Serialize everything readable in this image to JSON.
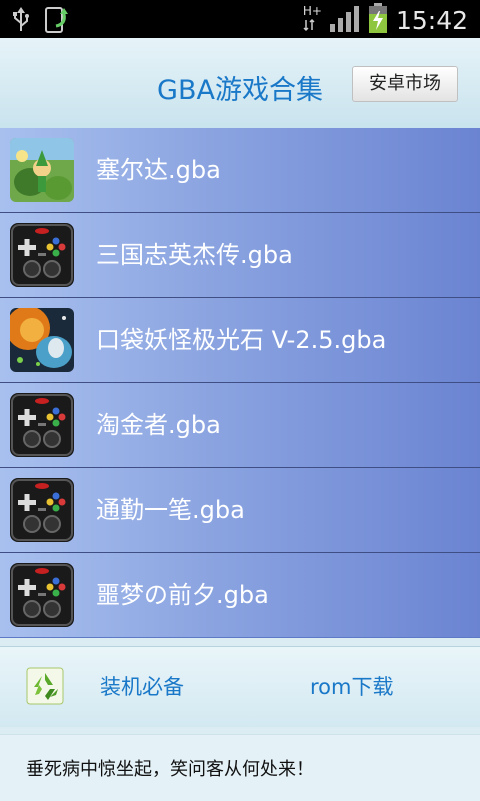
{
  "status_bar": {
    "time": "15:42",
    "network_type": "H+",
    "icons": [
      "usb-icon",
      "app-update-icon",
      "network-icon",
      "signal-icon",
      "battery-charging-icon"
    ]
  },
  "header": {
    "title": "GBA游戏合集",
    "market_button": "安卓市场"
  },
  "games": [
    {
      "name": "塞尔达.gba",
      "icon": "zelda-cover-icon"
    },
    {
      "name": "三国志英杰传.gba",
      "icon": "gamepad-icon"
    },
    {
      "name": "口袋妖怪极光石 V-2.5.gba",
      "icon": "pokemon-cover-icon"
    },
    {
      "name": "淘金者.gba",
      "icon": "gamepad-icon"
    },
    {
      "name": "通勤一笔.gba",
      "icon": "gamepad-icon"
    },
    {
      "name": "噩梦の前夕.gba",
      "icon": "gamepad-icon"
    }
  ],
  "bottom_bar": {
    "essentials_label": "装机必备",
    "rom_download_label": "rom下载",
    "icon": "recycle-icon"
  },
  "quote": "垂死病中惊坐起，笑问客从何处来！",
  "colors": {
    "accent_text": "#1a78c8",
    "list_background": "#7c96da",
    "status_bar": "#000000"
  }
}
